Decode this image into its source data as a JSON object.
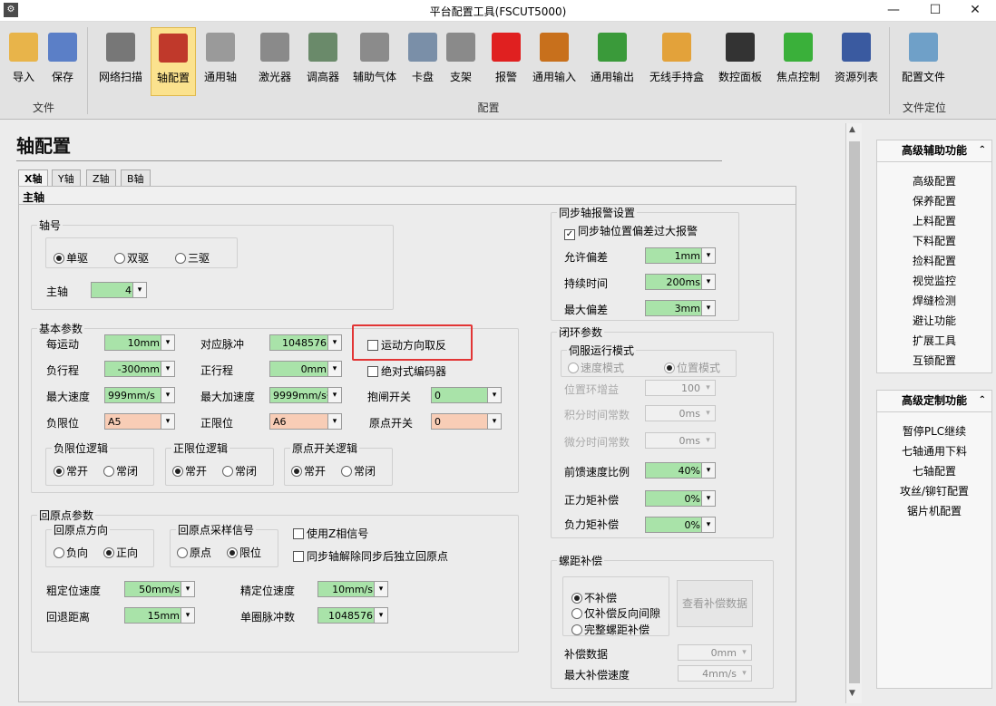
{
  "window": {
    "title": "平台配置工具(FSCUT5000)",
    "icon": "app-icon",
    "min": "—",
    "max": "☐",
    "close": "✕"
  },
  "ribbon": {
    "buttons": [
      {
        "label": "导入",
        "icon": "folder-open-icon",
        "color": "#e8b44a"
      },
      {
        "label": "保存",
        "icon": "floppy-disk-icon",
        "color": "#5b7fc7"
      },
      {
        "label": "网络扫描",
        "icon": "network-scan-icon",
        "color": "#777777"
      },
      {
        "label": "轴配置",
        "icon": "axis-motor-icon",
        "color": "#c0392b"
      },
      {
        "label": "通用轴",
        "icon": "generic-axis-icon",
        "color": "#9a9a9a"
      },
      {
        "label": "激光器",
        "icon": "laser-icon",
        "color": "#8a8a8a"
      },
      {
        "label": "调高器",
        "icon": "height-controller-icon",
        "color": "#6a8a6a"
      },
      {
        "label": "辅助气体",
        "icon": "gas-gauge-icon",
        "color": "#8b8b8b"
      },
      {
        "label": "卡盘",
        "icon": "chuck-icon",
        "color": "#7a8fa8"
      },
      {
        "label": "支架",
        "icon": "bracket-icon",
        "color": "#8a8a8a"
      },
      {
        "label": "报警",
        "icon": "alarm-light-icon",
        "color": "#e02020"
      },
      {
        "label": "通用输入",
        "icon": "input-arrow-icon",
        "color": "#c8701c"
      },
      {
        "label": "通用输出",
        "icon": "output-arrow-icon",
        "color": "#3a9a3a"
      },
      {
        "label": "无线手持盒",
        "icon": "wireless-handheld-icon",
        "color": "#e3a23a"
      },
      {
        "label": "数控面板",
        "icon": "cnc-panel-icon",
        "color": "#333333"
      },
      {
        "label": "焦点控制",
        "icon": "focus-control-icon",
        "color": "#3ab03a"
      },
      {
        "label": "资源列表",
        "icon": "resource-list-icon",
        "color": "#3a5aa0"
      },
      {
        "label": "配置文件",
        "icon": "config-file-icon",
        "color": "#6fa0c8"
      }
    ],
    "groups": {
      "file": "文件",
      "config": "配置",
      "locate": "文件定位"
    }
  },
  "page": {
    "title": "轴配置",
    "tabs": [
      "X轴",
      "Y轴",
      "Z轴",
      "B轴"
    ],
    "subtab": "主轴"
  },
  "axis_no": {
    "title": "轴号",
    "drive_opts": [
      "单驱",
      "双驱",
      "三驱"
    ],
    "main_axis_label": "主轴",
    "main_axis_value": "4"
  },
  "basic": {
    "title": "基本参数",
    "per_move_label": "每运动",
    "per_move_value": "10mm",
    "pulse_label": "对应脉冲",
    "pulse_value": "1048576",
    "neg_travel_label": "负行程",
    "neg_travel_value": "-300mm",
    "pos_travel_label": "正行程",
    "pos_travel_value": "0mm",
    "max_speed_label": "最大速度",
    "max_speed_value": "999mm/s",
    "max_accel_label": "最大加速度",
    "max_accel_value": "9999mm/s²",
    "reverse_label": "运动方向取反",
    "abs_encoder_label": "绝对式编码器",
    "brake_label": "抱闸开关",
    "brake_value": "0",
    "neg_limit_label": "负限位",
    "neg_limit_value": "A5",
    "pos_limit_label": "正限位",
    "pos_limit_value": "A6",
    "home_switch_label": "原点开关",
    "home_switch_value": "0",
    "neg_logic_title": "负限位逻辑",
    "pos_logic_title": "正限位逻辑",
    "home_logic_title": "原点开关逻辑",
    "logic_opts": [
      "常开",
      "常闭"
    ]
  },
  "homing": {
    "title": "回原点参数",
    "dir_title": "回原点方向",
    "dir_opts": [
      "负向",
      "正向"
    ],
    "signal_title": "回原点采样信号",
    "signal_opts": [
      "原点",
      "限位"
    ],
    "use_z_label": "使用Z相信号",
    "indep_label": "同步轴解除同步后独立回原点",
    "coarse_label": "粗定位速度",
    "coarse_value": "50mm/s",
    "fine_label": "精定位速度",
    "fine_value": "10mm/s",
    "retreat_label": "回退距离",
    "retreat_value": "15mm",
    "pulses_label": "单圈脉冲数",
    "pulses_value": "1048576"
  },
  "sync_alarm": {
    "title": "同步轴报警设置",
    "enable_label": "同步轴位置偏差过大报警",
    "allow_label": "允许偏差",
    "allow_value": "1mm",
    "duration_label": "持续时间",
    "duration_value": "200ms",
    "max_label": "最大偏差",
    "max_value": "3mm"
  },
  "closed_loop": {
    "title": "闭环参数",
    "servo_title": "伺服运行模式",
    "servo_opts": [
      "速度模式",
      "位置模式"
    ],
    "pos_gain_label": "位置环增益",
    "pos_gain_value": "100",
    "int_label": "积分时间常数",
    "int_value": "0ms",
    "diff_label": "微分时间常数",
    "diff_value": "0ms",
    "ff_label": "前馈速度比例",
    "ff_value": "40%",
    "pos_torque_label": "正力矩补偿",
    "pos_torque_value": "0%",
    "neg_torque_label": "负力矩补偿",
    "neg_torque_value": "0%"
  },
  "pitch": {
    "title": "螺距补偿",
    "opts": [
      "不补偿",
      "仅补偿反向间隙",
      "完整螺距补偿"
    ],
    "view_btn": "查看补偿数据",
    "data_label": "补偿数据",
    "data_value": "0mm",
    "max_speed_label": "最大补偿速度",
    "max_speed_value": "4mm/s"
  },
  "right_panel": {
    "adv_aux": {
      "title": "高级辅助功能",
      "items": [
        "高级配置",
        "保养配置",
        "上料配置",
        "下料配置",
        "捡料配置",
        "视觉监控",
        "焊缝检测",
        "避让功能",
        "扩展工具",
        "互锁配置"
      ]
    },
    "adv_custom": {
      "title": "高级定制功能",
      "items": [
        "暂停PLC继续",
        "七轴通用下料",
        "七轴配置",
        "攻丝/铆钉配置",
        "锯片机配置"
      ]
    }
  }
}
